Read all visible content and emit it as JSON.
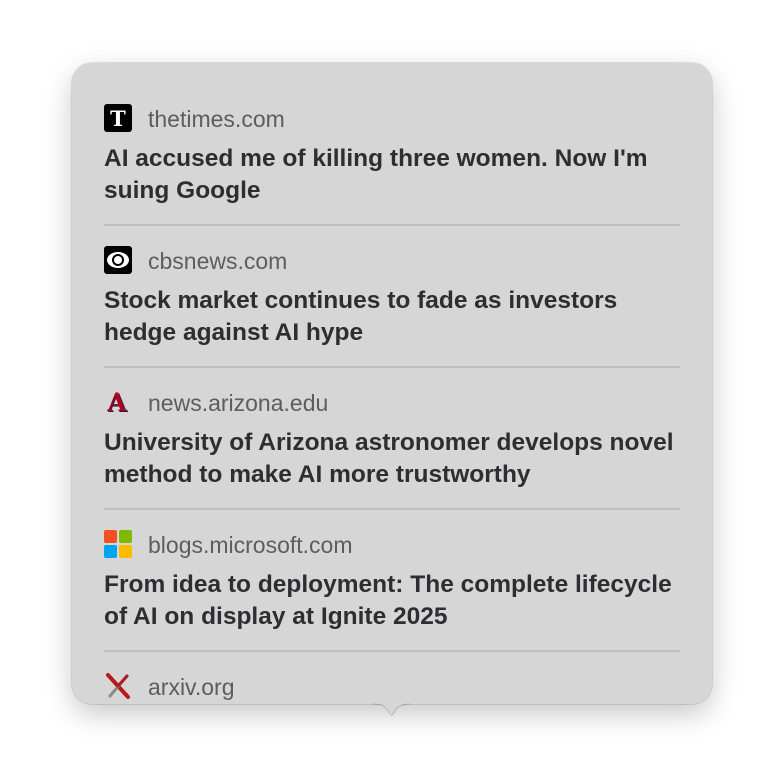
{
  "results": [
    {
      "domain": "thetimes.com",
      "headline": "AI accused me of killing three women. Now I'm suing Google",
      "favicon": "times-t-icon",
      "favicon_letter": "T"
    },
    {
      "domain": "cbsnews.com",
      "headline": "Stock market continues to fade as investors hedge against AI hype",
      "favicon": "cbs-eye-icon"
    },
    {
      "domain": "news.arizona.edu",
      "headline": "University of Arizona astronomer develops novel method to make AI more trustworthy",
      "favicon": "arizona-a-icon",
      "favicon_letter": "A"
    },
    {
      "domain": "blogs.microsoft.com",
      "headline": "From idea to deployment: The complete lifecycle of AI on display at Ignite 2025",
      "favicon": "microsoft-logo-icon"
    },
    {
      "domain": "arxiv.org",
      "headline": "",
      "favicon": "arxiv-x-icon"
    }
  ],
  "colors": {
    "panel_bg": "#d7d6d7",
    "domain_text": "#5d5c5e",
    "headline_text": "#2e2e30",
    "divider": "#bebdbf",
    "arizona_red": "#ab0520",
    "arizona_blue": "#0c234b",
    "ms_red": "#f25022",
    "ms_green": "#7fba00",
    "ms_blue": "#00a4ef",
    "ms_yellow": "#ffb900",
    "arxiv_red": "#b31b1b"
  }
}
